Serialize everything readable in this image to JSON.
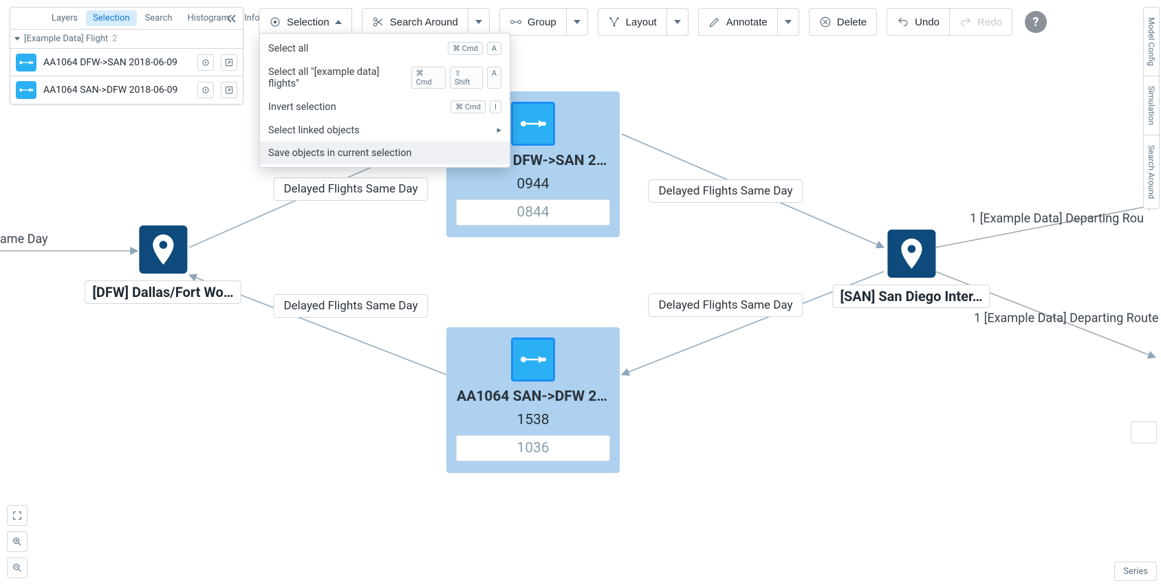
{
  "sidebar": {
    "tabs": [
      "Layers",
      "Selection",
      "Search",
      "Histogram",
      "Info"
    ],
    "active_tab_index": 1,
    "group_label": "[Example Data] Flight",
    "group_count": "2",
    "rows": [
      {
        "title": "AA1064 DFW->SAN 2018-06-09"
      },
      {
        "title": "AA1064 SAN->DFW 2018-06-09"
      }
    ]
  },
  "toolbar": {
    "selection": "Selection",
    "search_around": "Search Around",
    "group": "Group",
    "layout": "Layout",
    "annotate": "Annotate",
    "delete": "Delete",
    "undo": "Undo",
    "redo": "Redo",
    "help": "?"
  },
  "dropdown": {
    "items": [
      {
        "label": "Select all",
        "keys": [
          "⌘ Cmd",
          "A"
        ]
      },
      {
        "label": "Select all \"[example data] flights\"",
        "keys": [
          "⌘ Cmd",
          "⇧ Shift",
          "A"
        ]
      },
      {
        "label": "Invert selection",
        "keys": [
          "⌘ Cmd",
          "I"
        ]
      },
      {
        "label": "Select linked objects",
        "submenu": true
      },
      {
        "label": "Save objects in current selection",
        "hovered": true
      }
    ]
  },
  "right_rail": [
    "Model Config",
    "Simulation",
    "Search Around"
  ],
  "bottom_right": {
    "series": "Series"
  },
  "graph": {
    "airport_left": {
      "label": "[DFW] Dallas/Fort Wo…"
    },
    "airport_right": {
      "label": "[SAN] San Diego Inter…"
    },
    "flight_top": {
      "title": "AA1064 DFW->SAN 20…",
      "value1": "0944",
      "value2": "0844"
    },
    "flight_bottom": {
      "title": "AA1064 SAN->DFW 20…",
      "value1": "1538",
      "value2": "1036"
    },
    "edge_labels": {
      "tl": "Delayed Flights Same Day",
      "tr": "Delayed Flights Same Day",
      "bl": "Delayed Flights Same Day",
      "br": "Delayed Flights Same Day"
    },
    "ext_labels": {
      "left": "ame Day",
      "right_top": "1 [Example Data] Departing Rou",
      "right_bottom": "1 [Example Data] Departing Route"
    }
  }
}
